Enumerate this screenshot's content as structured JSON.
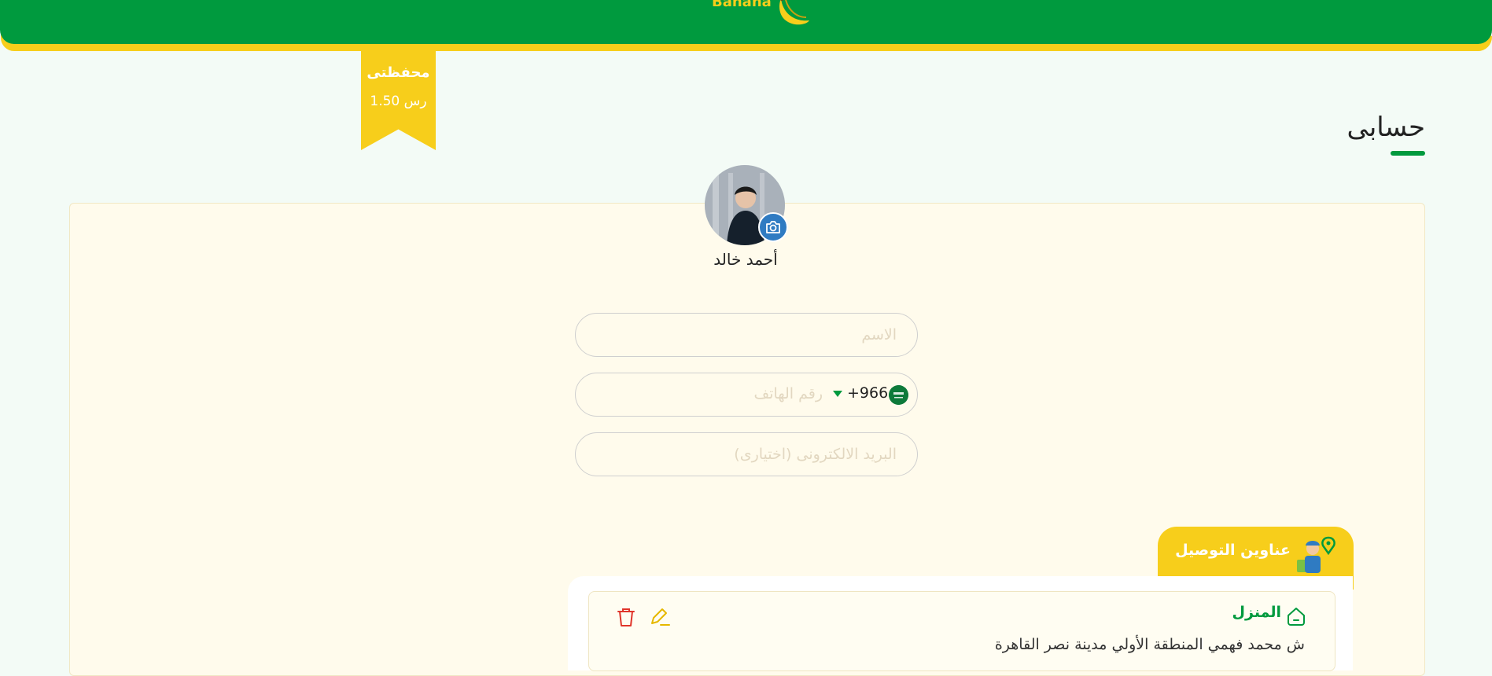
{
  "header": {
    "logo_text": "Banana",
    "logo_icon": "banana-icon"
  },
  "wallet": {
    "title": "محفظتى",
    "balance": "1.50 رس"
  },
  "page": {
    "title": "حسابى"
  },
  "profile": {
    "name": "أحمد خالد",
    "camera_icon": "camera-icon"
  },
  "form": {
    "name_placeholder": "الاسم",
    "phone_placeholder": "رقم الهاتف",
    "country_code": "+966",
    "email_placeholder": "البريد الالكترونى (اختيارى)"
  },
  "addresses": {
    "tab_label": "عناوين التوصيل",
    "items": [
      {
        "name": "المنزل",
        "text": "ش محمد فهمي المنطقة الأولي مدينة نصر القاهرة"
      }
    ]
  },
  "colors": {
    "primary": "#009a3e",
    "accent": "#f7ce1b",
    "danger": "#e0352b",
    "camera": "#2f7bc2"
  }
}
